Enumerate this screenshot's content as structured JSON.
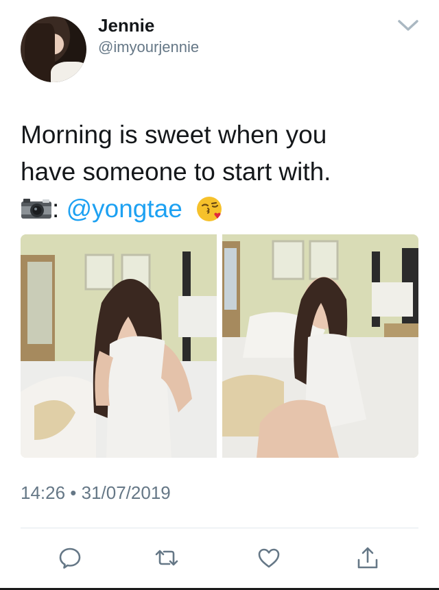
{
  "tweet": {
    "author_name": "Jennie",
    "author_handle": "@imyourjennie",
    "text_line1": "Morning is sweet when you",
    "text_line2": "have someone to start with.",
    "text_line3_prefix": ":",
    "mention": "@yongtae",
    "timestamp": "14:26 • 31/07/2019"
  },
  "icons": {
    "avatar": "avatar-photo",
    "menu": "chevron-down-icon",
    "camera": "camera-emoji-icon",
    "kiss": "face-blowing-kiss-emoji-icon",
    "reply": "reply-icon",
    "retweet": "retweet-icon",
    "like": "heart-icon",
    "share": "share-icon"
  },
  "colors": {
    "text": "#14171a",
    "secondary": "#657786",
    "link": "#1da1f2",
    "divider": "#e1e8ed"
  }
}
